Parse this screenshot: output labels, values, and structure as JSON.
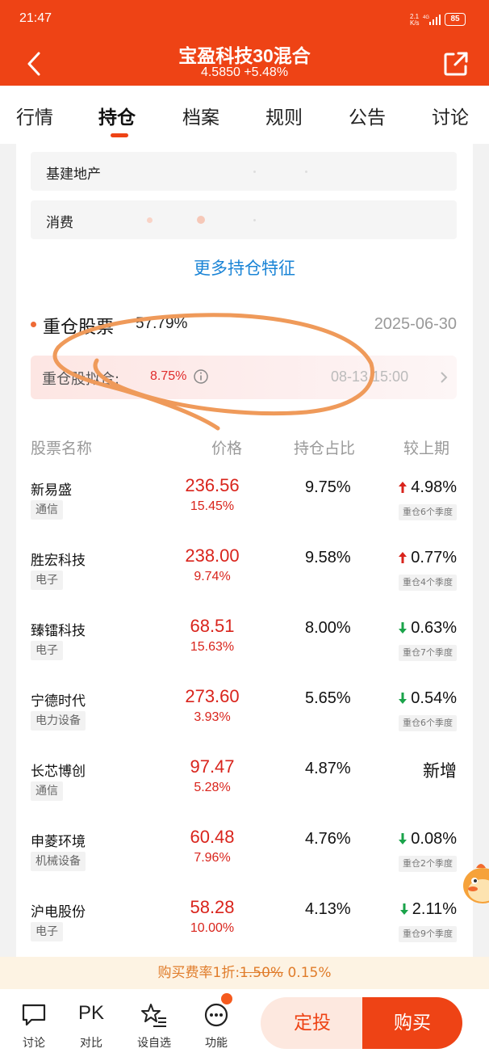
{
  "status_bar": {
    "time": "21:47",
    "net_speed_top": "2.1",
    "net_speed_bottom": "K/s",
    "network": "4G",
    "battery": "85"
  },
  "header": {
    "title": "宝盈科技30混合",
    "subtitle": "4.5850 +5.48%",
    "back_icon": "back-arrow-icon",
    "share_icon": "share-icon",
    "color": "#ee4315"
  },
  "tabs": [
    {
      "label": "行情",
      "active": false
    },
    {
      "label": "持仓",
      "active": true
    },
    {
      "label": "档案",
      "active": false
    },
    {
      "label": "规则",
      "active": false
    },
    {
      "label": "公告",
      "active": false
    },
    {
      "label": "讨论",
      "active": false
    }
  ],
  "features": [
    {
      "label": "基建地产"
    },
    {
      "label": "消费"
    }
  ],
  "more_features_link": "更多持仓特征",
  "heavy": {
    "title": "重仓股票",
    "percent": "57.79%",
    "date": "2025-06-30",
    "fit_label": "重仓股拟合:",
    "fit_value": "8.75%",
    "fit_time": "08-13 15:00"
  },
  "columns": {
    "name": "股票名称",
    "price": "价格",
    "holding": "持仓占比",
    "change": "较上期"
  },
  "stocks": [
    {
      "name": "新易盛",
      "sector": "通信",
      "price": "236.56",
      "change": "15.45%",
      "holding": "9.75%",
      "delta": "4.98%",
      "direction": "up",
      "badge": "重仓6个季度"
    },
    {
      "name": "胜宏科技",
      "sector": "电子",
      "price": "238.00",
      "change": "9.74%",
      "holding": "9.58%",
      "delta": "0.77%",
      "direction": "up",
      "badge": "重仓4个季度"
    },
    {
      "name": "臻镭科技",
      "sector": "电子",
      "price": "68.51",
      "change": "15.63%",
      "holding": "8.00%",
      "delta": "0.63%",
      "direction": "down",
      "badge": "重仓7个季度"
    },
    {
      "name": "宁德时代",
      "sector": "电力设备",
      "price": "273.60",
      "change": "3.93%",
      "holding": "5.65%",
      "delta": "0.54%",
      "direction": "down",
      "badge": "重仓6个季度"
    },
    {
      "name": "长芯博创",
      "sector": "通信",
      "price": "97.47",
      "change": "5.28%",
      "holding": "4.87%",
      "delta": "新增",
      "direction": "new",
      "badge": ""
    },
    {
      "name": "申菱环境",
      "sector": "机械设备",
      "price": "60.48",
      "change": "7.96%",
      "holding": "4.76%",
      "delta": "0.08%",
      "direction": "down",
      "badge": "重仓2个季度"
    },
    {
      "name": "沪电股份",
      "sector": "电子",
      "price": "58.28",
      "change": "10.00%",
      "holding": "4.13%",
      "delta": "2.11%",
      "direction": "down",
      "badge": "重仓9个季度"
    }
  ],
  "promo": {
    "prefix": "购买费率1折:",
    "old_rate": "1.50%",
    "new_rate": "0.15%"
  },
  "bottom_bar": {
    "items": [
      {
        "label": "讨论",
        "icon": "chat-bubble-icon"
      },
      {
        "label": "对比",
        "icon": "pk-icon",
        "glyph": "PK"
      },
      {
        "label": "设自选",
        "icon": "star-list-icon"
      },
      {
        "label": "功能",
        "icon": "more-dots-icon"
      }
    ],
    "fixed_invest_label": "定投",
    "buy_label": "购买"
  },
  "colors": {
    "accent": "#ee4315",
    "price_red": "#d9241c",
    "link_blue": "#1a84d6",
    "down_green": "#1aa34a",
    "annotation_orange": "#ef9a5a"
  }
}
